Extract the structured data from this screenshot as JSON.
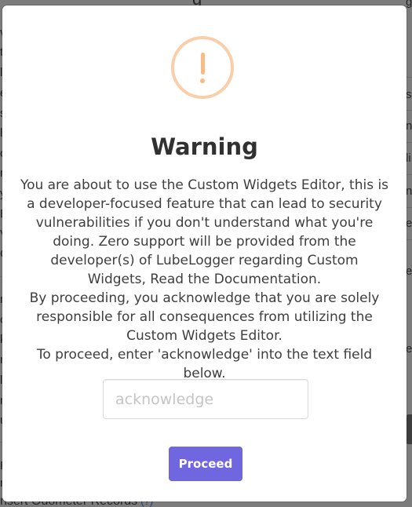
{
  "background": {
    "left_fragments": [
      "v",
      "ti",
      "le",
      "e",
      "s",
      "le",
      "c",
      "m",
      "y",
      "E",
      "V",
      "C",
      "",
      "n",
      "or",
      "k",
      "ri",
      "lt",
      "n",
      "u",
      "",
      "R",
      "n"
    ],
    "right_fragments": [
      "ge",
      "s",
      "n",
      "li",
      "ne",
      "e",
      "",
      "e",
      "",
      "e"
    ],
    "top_partial": "g",
    "bottom_text": "nsert Odometer Records",
    "bottom_help": "(?)"
  },
  "modal": {
    "icon": "warning-exclamation-icon",
    "title": "Warning",
    "message": {
      "line1": "You are about to use the Custom Widgets Editor, this is a developer-focused feature that can lead to security vulnerabilities if you don't understand what you're doing. Zero support will be provided from the developer(s) of LubeLogger regarding Custom Widgets, Read the Documentation.",
      "line2": "By proceeding, you acknowledge that you are solely responsible for all consequences from utilizing the Custom Widgets Editor.",
      "line3": "To proceed, enter 'acknowledge' into the text field below."
    },
    "input": {
      "placeholder": "acknowledge",
      "value": ""
    },
    "confirm_label": "Proceed",
    "colors": {
      "confirm": "#7066e0",
      "warning_icon": "#f8bb86"
    }
  }
}
